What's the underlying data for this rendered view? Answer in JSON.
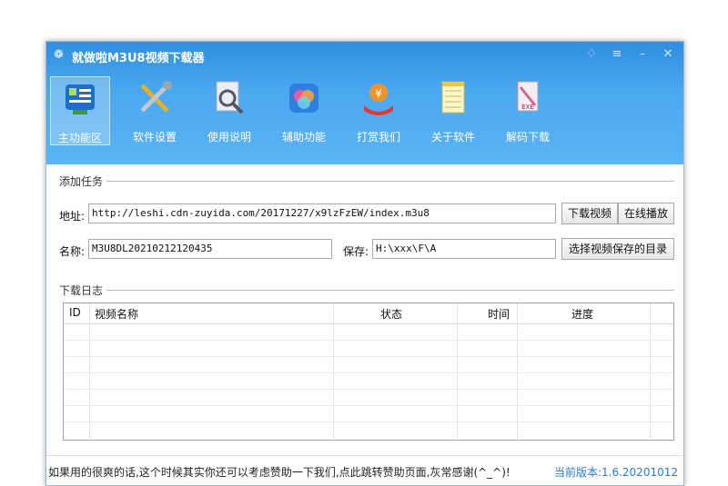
{
  "window": {
    "title": "就做啦M3U8视频下载器",
    "controls": [
      "skin-icon",
      "menu-icon",
      "minimize-icon",
      "close-icon"
    ]
  },
  "toolbar": {
    "items": [
      {
        "label": "主功能区",
        "icon": "main-function-icon",
        "active": true
      },
      {
        "label": "软件设置",
        "icon": "tools-icon",
        "active": false
      },
      {
        "label": "使用说明",
        "icon": "magnifier-icon",
        "active": false
      },
      {
        "label": "辅助功能",
        "icon": "assist-icon",
        "active": false
      },
      {
        "label": "打赏我们",
        "icon": "donate-icon",
        "active": false
      },
      {
        "label": "关于软件",
        "icon": "notepad-icon",
        "active": false
      },
      {
        "label": "解码下载",
        "icon": "exe-icon",
        "active": false
      }
    ]
  },
  "add_task": {
    "section_title": "添加任务",
    "address_label": "地址:",
    "address_value": "http://leshi.cdn-zuyida.com/20171227/x9lzFzEW/index.m3u8",
    "download_button": "下载视频",
    "play_button": "在线播放",
    "name_label": "名称:",
    "name_value": "M3U8DL20210212120435",
    "save_label": "保存:",
    "save_value": "H:\\xxx\\F\\A",
    "choose_dir_button": "选择视频保存的目录"
  },
  "log": {
    "section_title": "下载日志",
    "columns": [
      "ID",
      "视频名称",
      "状态",
      "时间",
      "进度"
    ],
    "rows": []
  },
  "status_bar": {
    "message": "如果用的很爽的话,这个时候其实你还可以考虑赞助一下我们,点此跳转赞助页面,灰常感谢(^_^)!",
    "version": "当前版本:1.6.20201012"
  },
  "colors": {
    "title_bar": "#3a9ae8",
    "version_text": "#2a7ad0"
  }
}
